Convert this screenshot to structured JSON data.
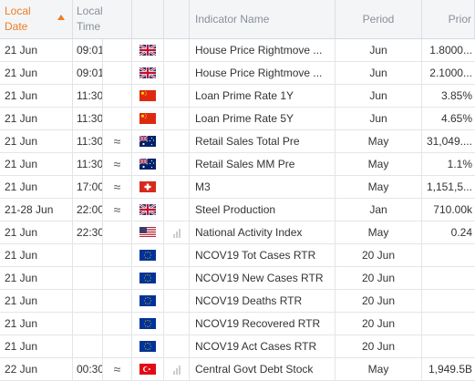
{
  "header": {
    "date_line1": "Local",
    "date_line2": "Date",
    "time_line1": "Local",
    "time_line2": "Time",
    "indicator": "Indicator Name",
    "period": "Period",
    "prior": "Prior"
  },
  "colors": {
    "accent": "#ef7d22",
    "header_text": "#8a9099",
    "grid_line": "#e3e5e8"
  },
  "rows": [
    {
      "date": "21 Jun",
      "time": "09:01",
      "vol": "",
      "flag": "uk-flag-icon",
      "chart": "",
      "name": "House Price Rightmove ...",
      "period": "Jun",
      "prior": "1.8000..."
    },
    {
      "date": "21 Jun",
      "time": "09:01",
      "vol": "",
      "flag": "uk-flag-icon",
      "chart": "",
      "name": "House Price Rightmove ...",
      "period": "Jun",
      "prior": "2.1000..."
    },
    {
      "date": "21 Jun",
      "time": "11:30",
      "vol": "",
      "flag": "china-flag-icon",
      "chart": "",
      "name": "Loan Prime Rate 1Y",
      "period": "Jun",
      "prior": "3.85%"
    },
    {
      "date": "21 Jun",
      "time": "11:30",
      "vol": "",
      "flag": "china-flag-icon",
      "chart": "",
      "name": "Loan Prime Rate 5Y",
      "period": "Jun",
      "prior": "4.65%"
    },
    {
      "date": "21 Jun",
      "time": "11:30",
      "vol": "≈",
      "flag": "australia-flag-icon",
      "chart": "",
      "name": "Retail Sales Total Pre",
      "period": "May",
      "prior": "31,049...."
    },
    {
      "date": "21 Jun",
      "time": "11:30",
      "vol": "≈",
      "flag": "australia-flag-icon",
      "chart": "",
      "name": "Retail Sales MM Pre",
      "period": "May",
      "prior": "1.1%"
    },
    {
      "date": "21 Jun",
      "time": "17:00",
      "vol": "≈",
      "flag": "switzerland-flag-icon",
      "chart": "",
      "name": "M3",
      "period": "May",
      "prior": "1,151,5..."
    },
    {
      "date": "21-28 Jun",
      "time": "22:00",
      "vol": "≈",
      "flag": "uk-flag-icon",
      "chart": "",
      "name": "Steel Production",
      "period": "Jan",
      "prior": "710.00k"
    },
    {
      "date": "21 Jun",
      "time": "22:30",
      "vol": "",
      "flag": "usa-flag-icon",
      "chart": "bars",
      "name": "National Activity Index",
      "period": "May",
      "prior": "0.24"
    },
    {
      "date": "21 Jun",
      "time": "",
      "vol": "",
      "flag": "eu-flag-icon",
      "chart": "",
      "name": "NCOV19 Tot Cases RTR",
      "period": "20 Jun",
      "prior": ""
    },
    {
      "date": "21 Jun",
      "time": "",
      "vol": "",
      "flag": "eu-flag-icon",
      "chart": "",
      "name": "NCOV19 New Cases RTR",
      "period": "20 Jun",
      "prior": ""
    },
    {
      "date": "21 Jun",
      "time": "",
      "vol": "",
      "flag": "eu-flag-icon",
      "chart": "",
      "name": "NCOV19 Deaths RTR",
      "period": "20 Jun",
      "prior": ""
    },
    {
      "date": "21 Jun",
      "time": "",
      "vol": "",
      "flag": "eu-flag-icon",
      "chart": "",
      "name": "NCOV19 Recovered RTR",
      "period": "20 Jun",
      "prior": ""
    },
    {
      "date": "21 Jun",
      "time": "",
      "vol": "",
      "flag": "eu-flag-icon",
      "chart": "",
      "name": "NCOV19 Act Cases RTR",
      "period": "20 Jun",
      "prior": ""
    },
    {
      "date": "22 Jun",
      "time": "00:30",
      "vol": "≈",
      "flag": "turkey-flag-icon",
      "chart": "bars",
      "name": "Central Govt Debt Stock",
      "period": "May",
      "prior": "1,949.5B"
    }
  ]
}
